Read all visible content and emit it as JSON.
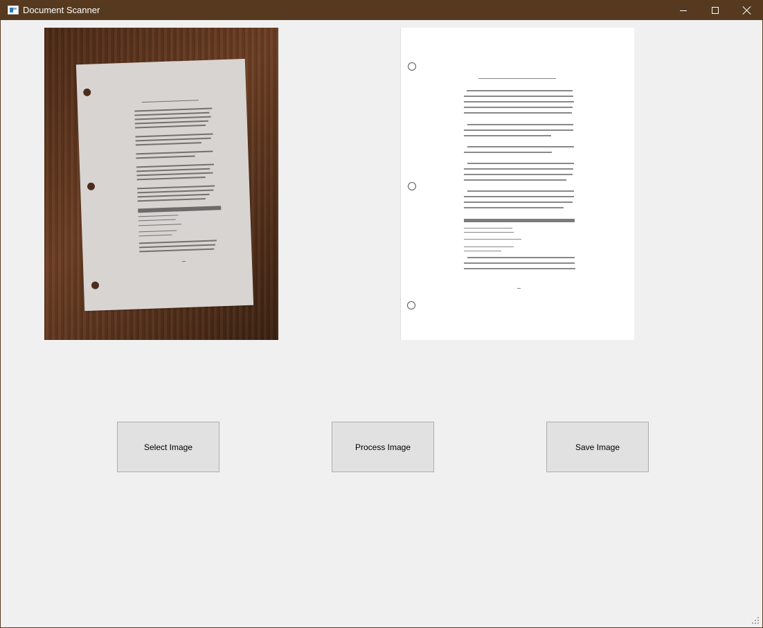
{
  "window": {
    "title": "Document Scanner"
  },
  "buttons": {
    "select": "Select Image",
    "process": "Process Image",
    "save": "Save Image"
  },
  "icons": {
    "app": "document-scanner-icon",
    "minimize": "minimize-icon",
    "maximize": "maximize-icon",
    "close": "close-icon"
  },
  "colors": {
    "titlebar": "#563a1f",
    "background": "#f0f0f0",
    "button": "#e1e1e1"
  }
}
